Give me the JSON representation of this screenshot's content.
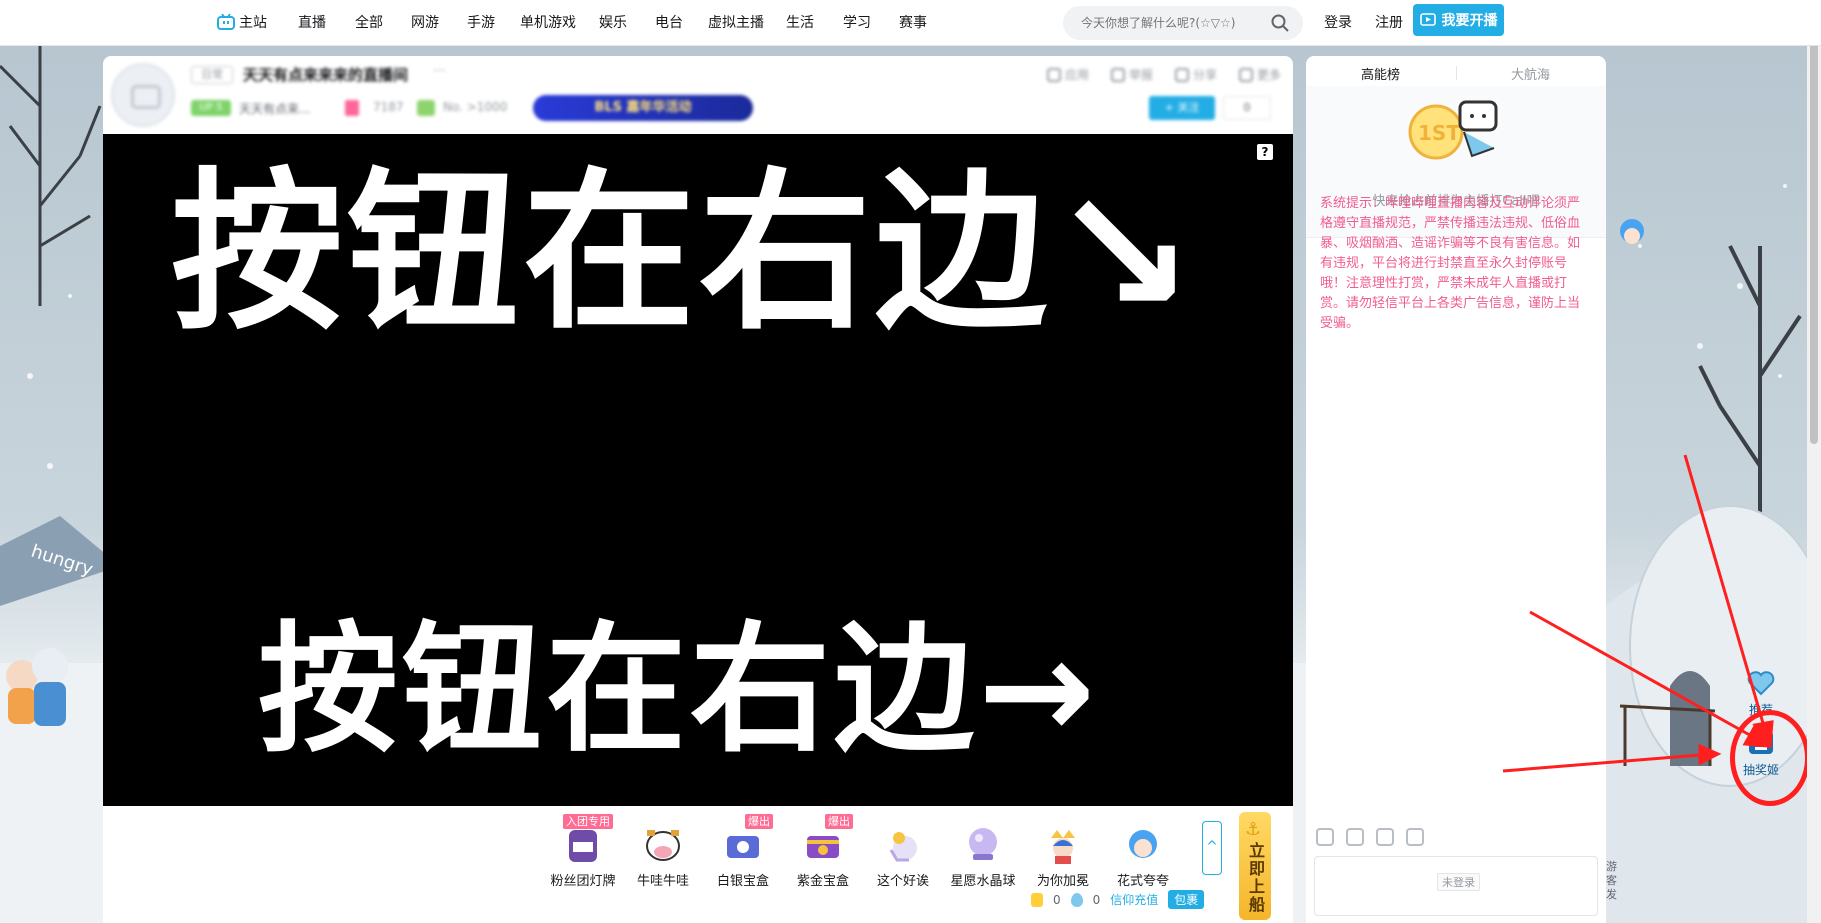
{
  "topnav": {
    "home": "主站",
    "items": [
      "直播",
      "全部",
      "网游",
      "手游",
      "单机游戏",
      "娱乐",
      "电台",
      "虚拟主播",
      "生活",
      "学习",
      "赛事"
    ],
    "search_placeholder": "今天你想了解什么呢?(☆▽☆)",
    "login": "登录",
    "register": "注册",
    "go_live": "我要开播"
  },
  "room": {
    "area_tag": "日常",
    "title": "天天有点来来来的直播间",
    "level_tag": "UP 5",
    "anchor_name": "天天有点来...",
    "popularity": "7187",
    "rank": "No. >1000",
    "event_banner": "BLS 嘉年华活动",
    "tools": [
      "应用",
      "举报",
      "分享",
      "更多"
    ],
    "follow": "+ 关注",
    "fans": "0"
  },
  "video": {
    "line1": "按钮在右边↘",
    "line2": "按钮在右边→",
    "help": "?"
  },
  "gifts": [
    {
      "name": "粉丝团灯牌",
      "tag": "入团专用"
    },
    {
      "name": "牛哇牛哇",
      "tag": ""
    },
    {
      "name": "白银宝盒",
      "tag": "爆出"
    },
    {
      "name": "紫金宝盒",
      "tag": "爆出"
    },
    {
      "name": "这个好诶",
      "tag": ""
    },
    {
      "name": "星愿水晶球",
      "tag": ""
    },
    {
      "name": "为你加冕",
      "tag": ""
    },
    {
      "name": "花式夸夸",
      "tag": ""
    }
  ],
  "gift_expand": "^",
  "board_ship": "立即上船",
  "wallet": {
    "coins": "0",
    "silver": "0",
    "recharge": "信仰充值",
    "pack": "包裹"
  },
  "side": {
    "tab_active": "高能榜",
    "tab_inactive": "大航海",
    "rank_hint": "快来抢占前排为主播打Call吧",
    "mascot_badge": "1ST",
    "notice": "系统提示：哔哩哔哩直播内容及互动评论须严格遵守直播规范，严禁传播违法违规、低俗血暴、吸烟酗酒、造谣诈骗等不良有害信息。如有违规，平台将进行封禁直至永久封停账号哦！注意理性打赏，严禁未成年人直播或打赏。请勿轻信平台上各类广告信息，谨防上当受骗。",
    "login_hint": "未登录",
    "guest_side": "游客发"
  },
  "float": {
    "recommend": "推荐",
    "lottery": "抽奖姬"
  },
  "colors": {
    "brand_blue": "#23ade5",
    "notice_pink": "#f25d8e",
    "annotation_red": "#ff1f1f"
  }
}
